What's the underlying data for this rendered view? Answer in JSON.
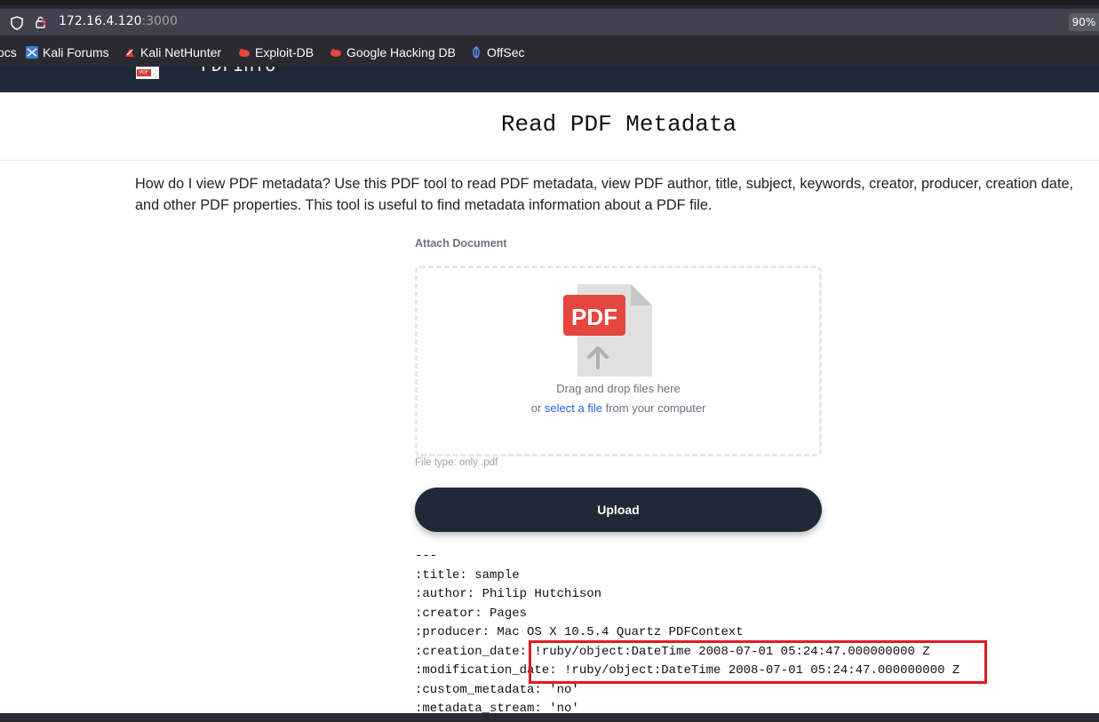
{
  "browser": {
    "url_host": "172.16.4.120",
    "url_port": ":3000",
    "zoom": "90%",
    "bookmarks": [
      {
        "label": "ocs",
        "icon": "none"
      },
      {
        "label": "Kali Forums",
        "icon": "kali-forums-icon"
      },
      {
        "label": "Kali NetHunter",
        "icon": "kali-nethunter-icon"
      },
      {
        "label": "Exploit-DB",
        "icon": "exploit-db-icon"
      },
      {
        "label": "Google Hacking DB",
        "icon": "ghdb-icon"
      },
      {
        "label": "OffSec",
        "icon": "offsec-icon"
      }
    ]
  },
  "site": {
    "logo_text": "PDFInfo",
    "logo_badge": "PDF"
  },
  "page": {
    "title": "Read PDF Metadata",
    "description": "How do I view PDF metadata? Use this PDF tool to read PDF metadata, view PDF author, title, subject, keywords, creator, producer, creation date, and other PDF properties. This tool is useful to find metadata information about a PDF file."
  },
  "upload": {
    "attach_label": "Attach Document",
    "icon_label": "PDF",
    "drag_text": "Drag and drop files here",
    "or_text": "or",
    "select_link": "select a file",
    "from_text": "from your computer",
    "filetype": "File type: only .pdf",
    "button": "Upload"
  },
  "output": {
    "lines": [
      "---",
      ":title: sample",
      ":author: Philip Hutchison",
      ":creator: Pages",
      ":producer: Mac OS X 10.5.4 Quartz PDFContext",
      ":creation_date: !ruby/object:DateTime 2008-07-01 05:24:47.000000000 Z",
      ":modification_date: !ruby/object:DateTime 2008-07-01 05:24:47.000000000 Z",
      ":custom_metadata: 'no'",
      ":metadata_stream: 'no'"
    ]
  },
  "colors": {
    "header_bg": "#1f2937",
    "highlight": "#e01b24",
    "link": "#2563eb",
    "pdf_red": "#e5463d"
  }
}
